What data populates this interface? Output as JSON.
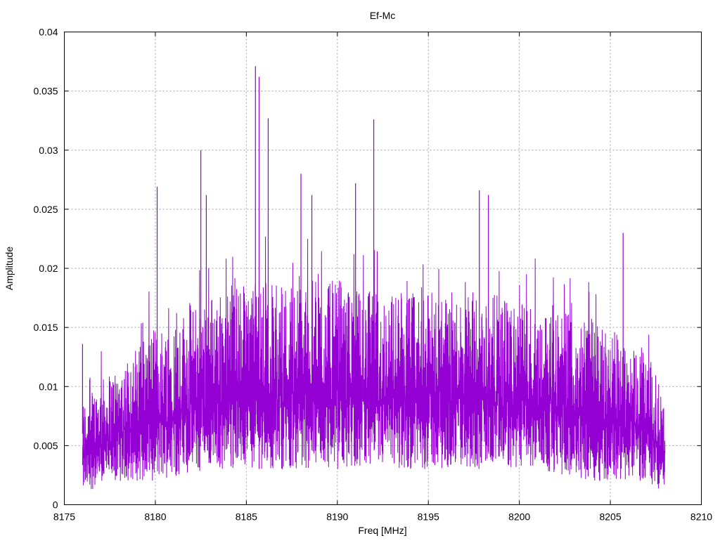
{
  "chart_data": {
    "type": "line",
    "title": "Ef-Mc",
    "xlabel": "Freq [MHz]",
    "ylabel": "Amplitude",
    "xlim": [
      8175,
      8210
    ],
    "ylim": [
      0,
      0.04
    ],
    "xticks": [
      "8175",
      "8180",
      "8185",
      "8190",
      "8195",
      "8200",
      "8205",
      "8210"
    ],
    "yticks": [
      "0",
      "0.005",
      "0.01",
      "0.015",
      "0.02",
      "0.025",
      "0.03",
      "0.035",
      "0.04"
    ],
    "grid": true,
    "legend": "none",
    "series": [
      {
        "name": "Ef-Mc",
        "color": "#9400d3",
        "x_range": [
          8176.0,
          8208.0
        ],
        "typical_band": {
          "x": [
            8176,
            8178,
            8180,
            8183,
            8186,
            8189,
            8192,
            8195,
            8198,
            8201,
            8204,
            8207,
            8208
          ],
          "low": [
            0.001,
            0.002,
            0.002,
            0.003,
            0.003,
            0.003,
            0.003,
            0.003,
            0.003,
            0.003,
            0.002,
            0.002,
            0.001
          ],
          "high": [
            0.009,
            0.012,
            0.015,
            0.018,
            0.019,
            0.019,
            0.018,
            0.018,
            0.018,
            0.017,
            0.016,
            0.013,
            0.009
          ]
        },
        "peaks": [
          {
            "x": 8176.0,
            "y": 0.0136
          },
          {
            "x": 8180.1,
            "y": 0.0269
          },
          {
            "x": 8182.5,
            "y": 0.03
          },
          {
            "x": 8182.8,
            "y": 0.0262
          },
          {
            "x": 8185.5,
            "y": 0.0371
          },
          {
            "x": 8185.7,
            "y": 0.0362
          },
          {
            "x": 8186.2,
            "y": 0.0327
          },
          {
            "x": 8188.0,
            "y": 0.028
          },
          {
            "x": 8188.6,
            "y": 0.0262
          },
          {
            "x": 8191.0,
            "y": 0.0272
          },
          {
            "x": 8192.0,
            "y": 0.0326
          },
          {
            "x": 8197.8,
            "y": 0.0266
          },
          {
            "x": 8198.3,
            "y": 0.0262
          },
          {
            "x": 8205.7,
            "y": 0.023
          }
        ]
      }
    ]
  }
}
